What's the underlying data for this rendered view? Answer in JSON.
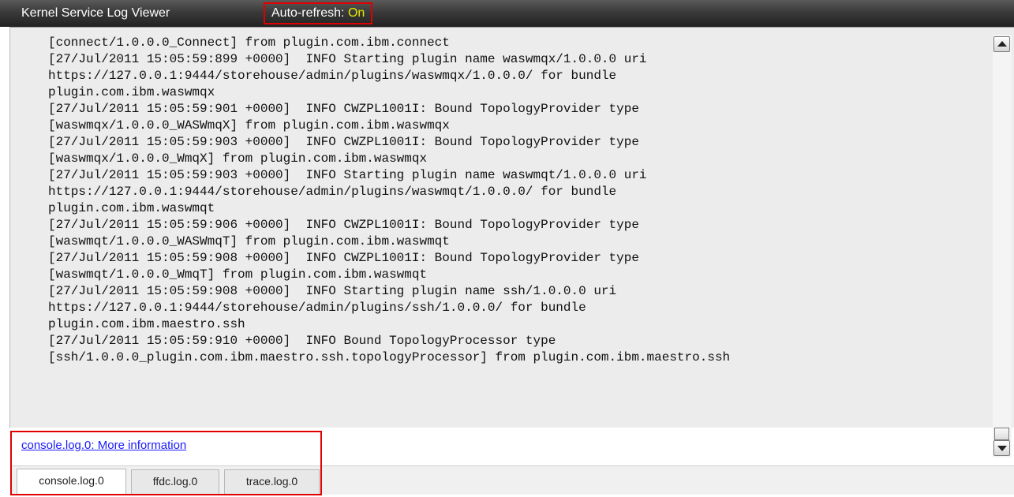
{
  "titlebar": {
    "title": "Kernel Service Log Viewer",
    "auto_refresh_label": "Auto-refresh:",
    "auto_refresh_state": "On"
  },
  "log": {
    "lines": [
      "[connect/1.0.0.0_Connect] from plugin.com.ibm.connect",
      "[27/Jul/2011 15:05:59:899 +0000]  INFO Starting plugin name waswmqx/1.0.0.0 uri",
      "https://127.0.0.1:9444/storehouse/admin/plugins/waswmqx/1.0.0.0/ for bundle",
      "plugin.com.ibm.waswmqx",
      "[27/Jul/2011 15:05:59:901 +0000]  INFO CWZPL1001I: Bound TopologyProvider type",
      "[waswmqx/1.0.0.0_WASWmqX] from plugin.com.ibm.waswmqx",
      "[27/Jul/2011 15:05:59:903 +0000]  INFO CWZPL1001I: Bound TopologyProvider type",
      "[waswmqx/1.0.0.0_WmqX] from plugin.com.ibm.waswmqx",
      "[27/Jul/2011 15:05:59:903 +0000]  INFO Starting plugin name waswmqt/1.0.0.0 uri",
      "https://127.0.0.1:9444/storehouse/admin/plugins/waswmqt/1.0.0.0/ for bundle",
      "plugin.com.ibm.waswmqt",
      "[27/Jul/2011 15:05:59:906 +0000]  INFO CWZPL1001I: Bound TopologyProvider type",
      "[waswmqt/1.0.0.0_WASWmqT] from plugin.com.ibm.waswmqt",
      "[27/Jul/2011 15:05:59:908 +0000]  INFO CWZPL1001I: Bound TopologyProvider type",
      "[waswmqt/1.0.0.0_WmqT] from plugin.com.ibm.waswmqt",
      "[27/Jul/2011 15:05:59:908 +0000]  INFO Starting plugin name ssh/1.0.0.0 uri",
      "https://127.0.0.1:9444/storehouse/admin/plugins/ssh/1.0.0.0/ for bundle",
      "plugin.com.ibm.maestro.ssh",
      "[27/Jul/2011 15:05:59:910 +0000]  INFO Bound TopologyProcessor type",
      "[ssh/1.0.0.0_plugin.com.ibm.maestro.ssh.topologyProcessor] from plugin.com.ibm.maestro.ssh"
    ]
  },
  "footer": {
    "more_info_link": "console.log.0: More information",
    "tabs": [
      {
        "label": "console.log.0",
        "active": true
      },
      {
        "label": "ffdc.log.0",
        "active": false
      },
      {
        "label": "trace.log.0",
        "active": false
      }
    ]
  },
  "colors": {
    "highlight_border": "#e00000",
    "auto_refresh_on": "#e8e800",
    "link": "#1a1aff"
  }
}
